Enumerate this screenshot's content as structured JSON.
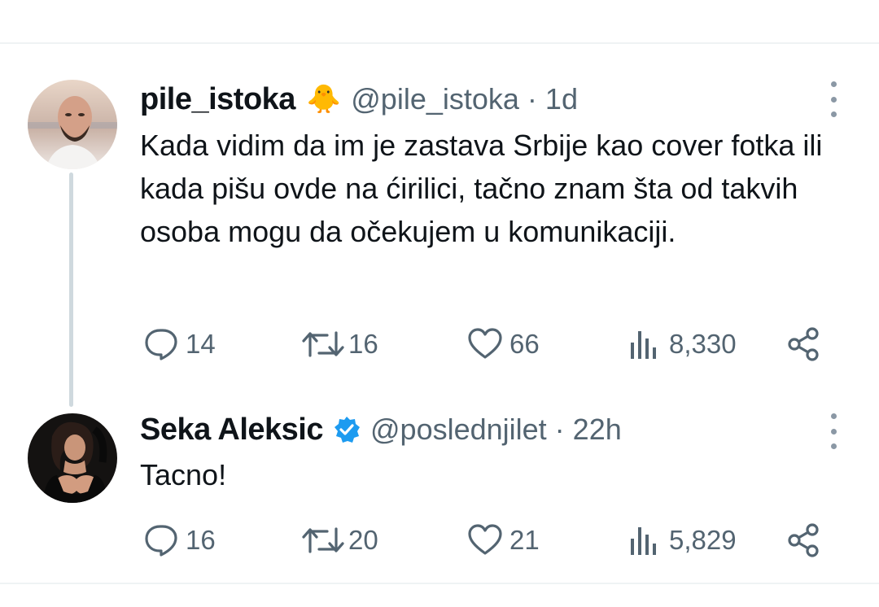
{
  "tweets": [
    {
      "name": "pile_istoka",
      "emoji": "🐥",
      "handle": "@pile_istoka",
      "separator": "·",
      "time": "1d",
      "text": "Kada vidim da im je zastava Srbije kao cover fotka ili kada pišu ovde na ćirilici, tačno znam šta od takvih osoba mogu da očekujem u komunikaciji.",
      "replies": "14",
      "reposts": "16",
      "likes": "66",
      "views": "8,330"
    },
    {
      "name": "Seka Aleksic",
      "verified": true,
      "handle": "@poslednjilet",
      "separator": "·",
      "time": "22h",
      "text": "Tacno!",
      "replies": "16",
      "reposts": "20",
      "likes": "21",
      "views": "5,829"
    }
  ],
  "icons": {
    "reply": "reply-icon",
    "repost": "repost-icon",
    "like": "heart-icon",
    "views": "views-icon",
    "share": "share-icon",
    "more": "more-options-icon",
    "verified": "verified-badge-icon"
  },
  "colors": {
    "text": "#0f1419",
    "secondary": "#536471",
    "verified": "#1d9bf0",
    "line": "#cfd9de"
  }
}
